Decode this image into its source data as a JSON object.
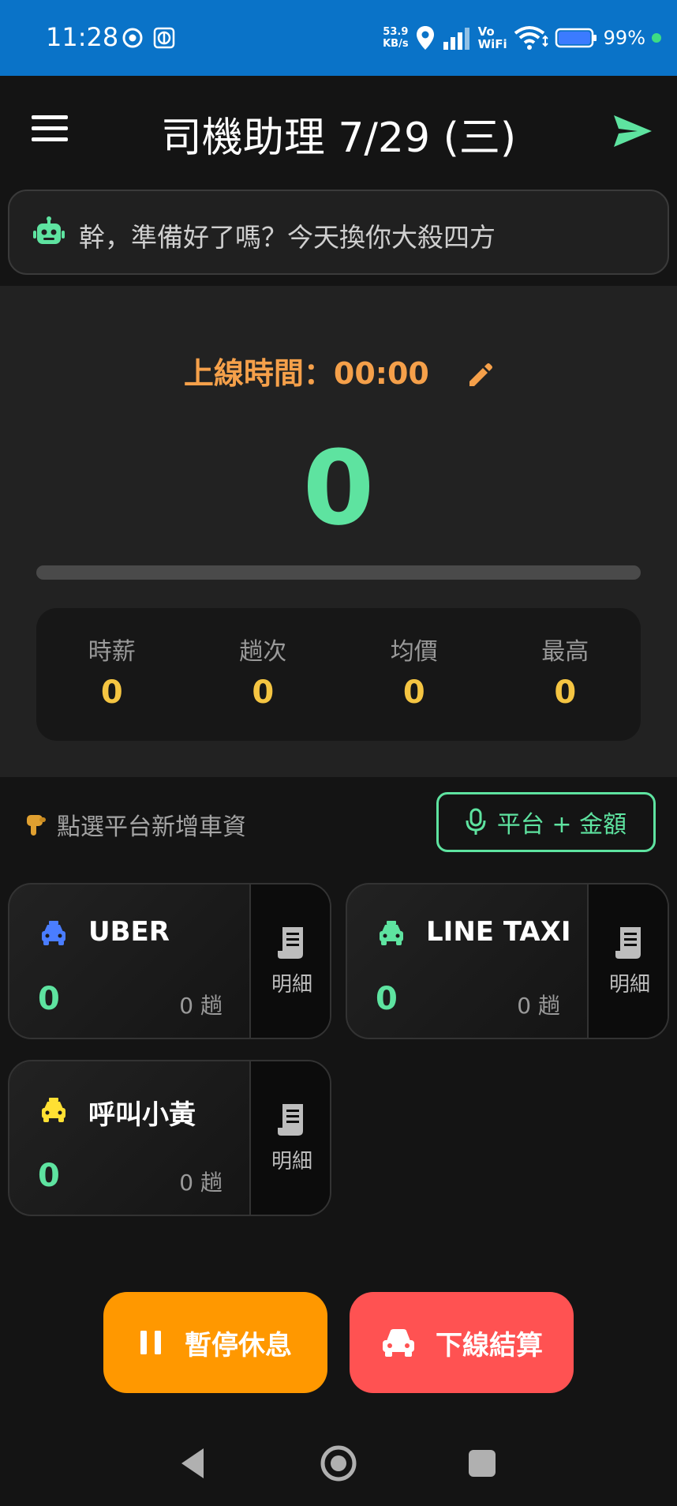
{
  "status_bar": {
    "time": "11:28",
    "speed_value": "53.9",
    "speed_unit": "KB/s",
    "vowifi_top": "Vo",
    "vowifi_bottom": "WiFi",
    "battery": "99%"
  },
  "app_bar": {
    "title": "司機助理 7/29 (三)",
    "menu_icon": "menu-icon",
    "send_icon": "send-icon"
  },
  "greeting": {
    "icon": "robot-icon",
    "text": "幹，準備好了嗎？今天換你大殺四方"
  },
  "summary": {
    "online_time_label": "上線時間：00:00",
    "total_amount": "0",
    "progress": 0,
    "stats": [
      {
        "label": "時薪",
        "value": "0"
      },
      {
        "label": "趟次",
        "value": "0"
      },
      {
        "label": "均價",
        "value": "0"
      },
      {
        "label": "最高",
        "value": "0"
      }
    ]
  },
  "hint": {
    "icon": "pointing-down-hand-icon",
    "text": "點選平台新增車資"
  },
  "voice_button": {
    "icon": "microphone-icon",
    "label": "平台 + 金額"
  },
  "platforms": [
    {
      "name": "UBER",
      "amount": "0",
      "trips": "0 趟",
      "detail_label": "明細",
      "color": "#4a7dff"
    },
    {
      "name": "LINE TAXI",
      "amount": "0",
      "trips": "0 趟",
      "detail_label": "明細",
      "color": "#5ee3a0"
    },
    {
      "name": "呼叫小黃",
      "amount": "0",
      "trips": "0 趟",
      "detail_label": "明細",
      "color": "#ffe033"
    }
  ],
  "actions": {
    "pause_label": "暫停休息",
    "end_label": "下線結算"
  },
  "colors": {
    "accent_green": "#5ee3a0",
    "accent_orange": "#f5a04a",
    "stat_yellow": "#f5c542",
    "pause_orange": "#ff9800",
    "end_red": "#ff5252",
    "status_blue": "#0a73c8"
  }
}
